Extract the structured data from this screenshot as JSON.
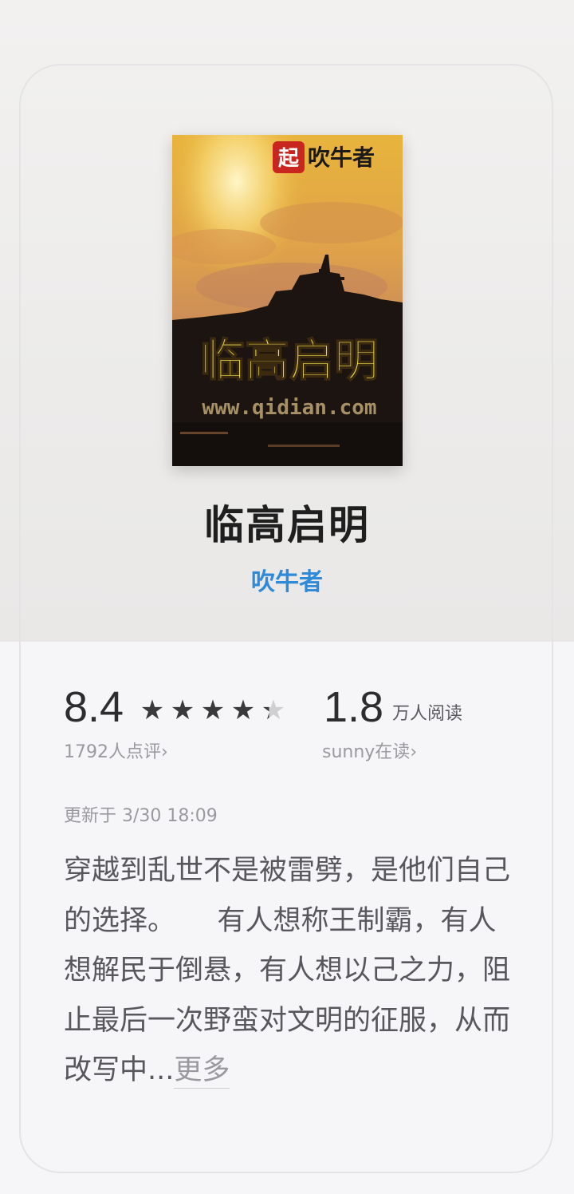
{
  "book": {
    "title": "临高启明",
    "author": "吹牛者",
    "cover": {
      "badge_char": "起",
      "badge_author": "吹牛者",
      "cover_title": "临高启明",
      "watermark": "www.qidian.com"
    }
  },
  "stats": {
    "score": "8.4",
    "rating_fraction": 0.84,
    "stars": [
      "★",
      "★",
      "★",
      "★",
      "★"
    ],
    "reviews_label": "1792人点评",
    "readers_count": "1.8",
    "readers_unit": "万人阅读",
    "friend_reading_label": "sunny在读",
    "chevron": "›"
  },
  "updated_label": "更新于 3/30 18:09",
  "intro": {
    "text": "穿越到乱世不是被雷劈，是他们自己的选择。　　有人想称王制霸，有人想解民于倒悬，有人想以己之力，阻止最后一次野蛮对文明的征服，从而改写中...",
    "more_label": "更多"
  },
  "colors": {
    "author_blue": "#2f8ad8",
    "text_dark": "#2d2d30",
    "text_gray": "#9a9a9e",
    "body_text": "#58585c"
  }
}
